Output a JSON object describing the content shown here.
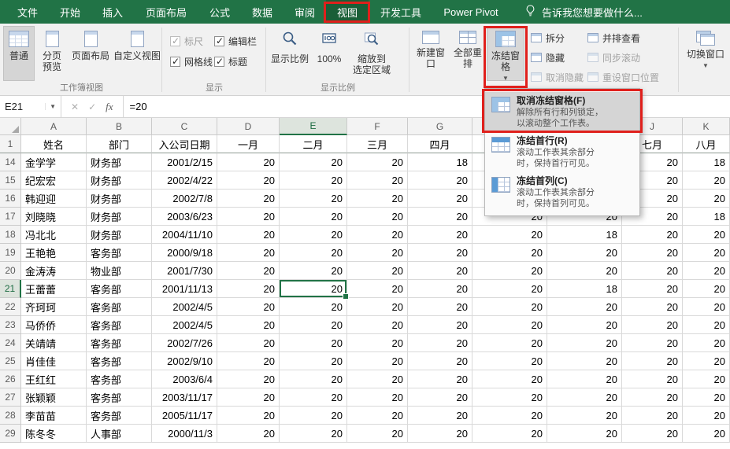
{
  "colors": {
    "accent": "#217346",
    "annotation": "#e0201c",
    "tab_bar": "#217346"
  },
  "tabbar": {
    "tabs": [
      {
        "id": "file",
        "label": "文件"
      },
      {
        "id": "home",
        "label": "开始"
      },
      {
        "id": "insert",
        "label": "插入"
      },
      {
        "id": "page-layout",
        "label": "页面布局"
      },
      {
        "id": "formulas",
        "label": "公式"
      },
      {
        "id": "data",
        "label": "数据"
      },
      {
        "id": "review",
        "label": "审阅"
      },
      {
        "id": "view",
        "label": "视图",
        "active": true,
        "annotated": true
      },
      {
        "id": "developer",
        "label": "开发工具"
      },
      {
        "id": "power-pivot",
        "label": "Power Pivot"
      }
    ],
    "tell_me": "告诉我您想要做什么..."
  },
  "ribbon": {
    "workbook_views": {
      "group_label": "工作簿视图",
      "normal": "普通",
      "page_break_preview": "分页\n预览",
      "page_layout": "页面布局",
      "custom_views": "自定义视图"
    },
    "show": {
      "group_label": "显示",
      "ruler": "标尺",
      "formula_bar": "编辑栏",
      "gridlines": "网格线",
      "headings": "标题"
    },
    "zoom": {
      "group_label": "显示比例",
      "zoom": "显示比例",
      "zoom_100": "100%",
      "zoom_to_selection": "缩放到\n选定区域"
    },
    "window": {
      "new_window": "新建窗口",
      "arrange_all": "全部重排",
      "freeze_panes": "冻结窗格",
      "split": "拆分",
      "hide": "隐藏",
      "unhide": "取消隐藏",
      "view_side_by_side": "并排查看",
      "synchronous_scrolling": "同步滚动",
      "reset_window_position": "重设窗口位置",
      "switch_windows": "切换窗口"
    }
  },
  "formula_bar": {
    "name_box": "E21",
    "fx_label": "fx",
    "formula": "=20"
  },
  "freeze_menu": {
    "items": [
      {
        "icon": "unfreeze-panes-icon",
        "title": "取消冻结窗格(F)",
        "desc": "解除所有行和列锁定，\n以滚动整个工作表。",
        "hovered": true,
        "annotated": true
      },
      {
        "icon": "freeze-top-row-icon",
        "title": "冻结首行(R)",
        "desc": "滚动工作表其余部分\n时，保持首行可见。"
      },
      {
        "icon": "freeze-first-column-icon",
        "title": "冻结首列(C)",
        "desc": "滚动工作表其余部分\n时，保持首列可见。"
      }
    ]
  },
  "sheet": {
    "columns": [
      "A",
      "B",
      "C",
      "D",
      "E",
      "F",
      "G",
      "H",
      "I",
      "J",
      "K"
    ],
    "active_cell": "E21",
    "header_row": {
      "num": "1",
      "cells": [
        "姓名",
        "部门",
        "入公司日期",
        "一月",
        "二月",
        "三月",
        "四月",
        "",
        "",
        "七月",
        "八月"
      ]
    },
    "rows": [
      {
        "num": "14",
        "name": "金学学",
        "dept": "财务部",
        "date": "2001/2/15",
        "months": [
          "20",
          "20",
          "20",
          "18",
          "",
          "",
          "20",
          "18"
        ]
      },
      {
        "num": "15",
        "name": "纪宏宏",
        "dept": "财务部",
        "date": "2002/4/22",
        "months": [
          "20",
          "20",
          "20",
          "20",
          "",
          "",
          "20",
          "20"
        ]
      },
      {
        "num": "16",
        "name": "韩迎迎",
        "dept": "财务部",
        "date": "2002/7/8",
        "months": [
          "20",
          "20",
          "20",
          "20",
          "",
          "",
          "20",
          "20"
        ]
      },
      {
        "num": "17",
        "name": "刘晓晓",
        "dept": "财务部",
        "date": "2003/6/23",
        "months": [
          "20",
          "20",
          "20",
          "20",
          "20",
          "20",
          "20",
          "18"
        ]
      },
      {
        "num": "18",
        "name": "冯北北",
        "dept": "财务部",
        "date": "2004/11/10",
        "months": [
          "20",
          "20",
          "20",
          "20",
          "20",
          "18",
          "20",
          "20"
        ]
      },
      {
        "num": "19",
        "name": "王艳艳",
        "dept": "客务部",
        "date": "2000/9/18",
        "months": [
          "20",
          "20",
          "20",
          "20",
          "20",
          "20",
          "20",
          "20"
        ]
      },
      {
        "num": "20",
        "name": "金涛涛",
        "dept": "物业部",
        "date": "2001/7/30",
        "months": [
          "20",
          "20",
          "20",
          "20",
          "20",
          "20",
          "20",
          "20"
        ]
      },
      {
        "num": "21",
        "name": "王蕾蕾",
        "dept": "客务部",
        "date": "2001/11/13",
        "months": [
          "20",
          "20",
          "20",
          "20",
          "20",
          "18",
          "20",
          "20"
        ]
      },
      {
        "num": "22",
        "name": "齐珂珂",
        "dept": "客务部",
        "date": "2002/4/5",
        "months": [
          "20",
          "20",
          "20",
          "20",
          "20",
          "20",
          "20",
          "20"
        ]
      },
      {
        "num": "23",
        "name": "马侨侨",
        "dept": "客务部",
        "date": "2002/4/5",
        "months": [
          "20",
          "20",
          "20",
          "20",
          "20",
          "20",
          "20",
          "20"
        ]
      },
      {
        "num": "24",
        "name": "关靖靖",
        "dept": "客务部",
        "date": "2002/7/26",
        "months": [
          "20",
          "20",
          "20",
          "20",
          "20",
          "20",
          "20",
          "20"
        ]
      },
      {
        "num": "25",
        "name": "肖佳佳",
        "dept": "客务部",
        "date": "2002/9/10",
        "months": [
          "20",
          "20",
          "20",
          "20",
          "20",
          "20",
          "20",
          "20"
        ]
      },
      {
        "num": "26",
        "name": "王红红",
        "dept": "客务部",
        "date": "2003/6/4",
        "months": [
          "20",
          "20",
          "20",
          "20",
          "20",
          "20",
          "20",
          "20"
        ]
      },
      {
        "num": "27",
        "name": "张颖颖",
        "dept": "客务部",
        "date": "2003/11/17",
        "months": [
          "20",
          "20",
          "20",
          "20",
          "20",
          "20",
          "20",
          "20"
        ]
      },
      {
        "num": "28",
        "name": "李苗苗",
        "dept": "客务部",
        "date": "2005/11/17",
        "months": [
          "20",
          "20",
          "20",
          "20",
          "20",
          "20",
          "20",
          "20"
        ]
      },
      {
        "num": "29",
        "name": "陈冬冬",
        "dept": "人事部",
        "date": "2000/11/3",
        "months": [
          "20",
          "20",
          "20",
          "20",
          "20",
          "20",
          "20",
          "20"
        ]
      }
    ]
  }
}
